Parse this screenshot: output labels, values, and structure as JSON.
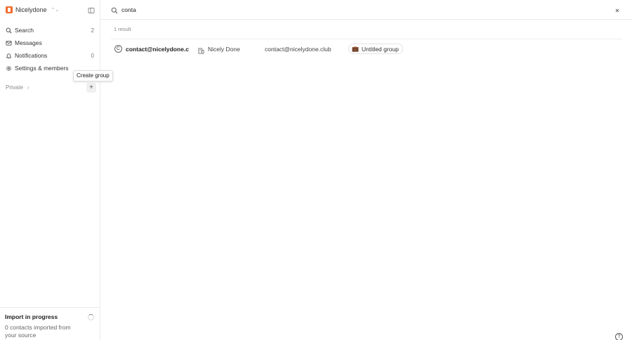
{
  "sidebar": {
    "workspace": {
      "name": "Nicelydone",
      "logo_color": "#f06a2c"
    },
    "nav": [
      {
        "label": "Search",
        "count": "2",
        "icon": "search-icon"
      },
      {
        "label": "Messages",
        "count": "",
        "icon": "envelope-icon"
      },
      {
        "label": "Notifications",
        "count": "0",
        "icon": "bell-icon"
      },
      {
        "label": "Settings & members",
        "count": "",
        "icon": "gear-icon"
      }
    ],
    "private_label": "Private",
    "create_group_tooltip": "Create group",
    "import": {
      "title": "Import in progress",
      "text": "0 contacts imported from your source"
    }
  },
  "search": {
    "query": "conta",
    "results_count": "1 result",
    "results": [
      {
        "avatar_letter": "C",
        "email_bold": "contact@nicelydone.club",
        "company": "Nicely Done",
        "email": "contact@nicelydone.club",
        "group_emoji": "💼",
        "group": "Untitled group"
      }
    ]
  },
  "help_label": "?"
}
